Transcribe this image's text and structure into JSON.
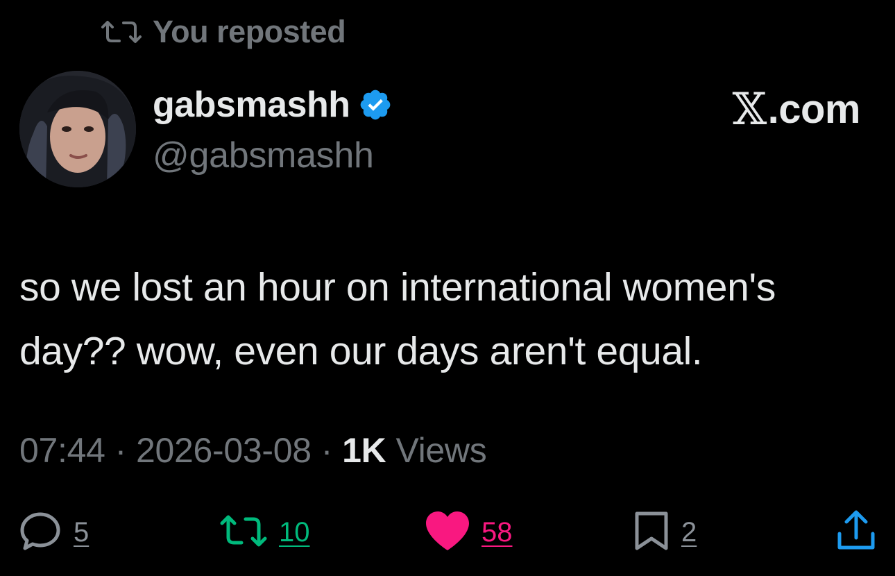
{
  "repost_banner": {
    "label": "You reposted",
    "icon": "retweet-icon"
  },
  "author": {
    "display_name": "gabsmashh",
    "handle": "@gabsmashh",
    "verified": true,
    "verified_color": "#1d9bf0",
    "avatar_icon": "profile-photo"
  },
  "brand": {
    "x": "𝕏",
    "suffix": ".com"
  },
  "tweet": {
    "text": "so we lost an hour on international women's day?? wow, even our days aren't equal."
  },
  "meta": {
    "time": "07:44",
    "separator": "·",
    "date": "2026-03-08",
    "views_count": "1K",
    "views_label": "Views"
  },
  "actions": {
    "reply": {
      "count": "5",
      "icon": "reply-icon",
      "color": "#8b9198"
    },
    "retweet": {
      "count": "10",
      "icon": "retweet-icon",
      "color": "#00ba7c"
    },
    "like": {
      "count": "58",
      "icon": "heart-icon",
      "color": "#f91880"
    },
    "bookmark": {
      "count": "2",
      "icon": "bookmark-icon",
      "color": "#8b9198"
    },
    "share": {
      "icon": "share-icon",
      "color": "#1d9bf0"
    }
  }
}
